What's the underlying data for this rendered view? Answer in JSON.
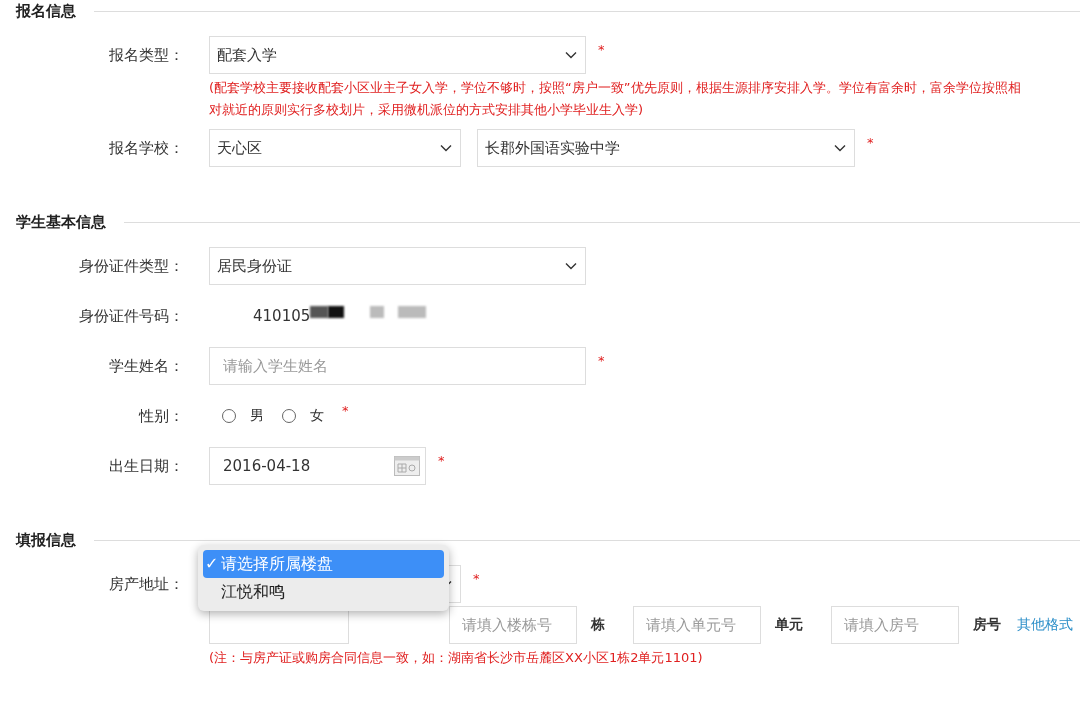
{
  "sections": [
    {
      "title": "报名信息",
      "rows": [
        {
          "kind": "select",
          "label": "报名类型：",
          "value": "配套入学",
          "required": "*",
          "note": "(配套学校主要接收配套小区业主子女入学，学位不够时，按照“房户一致”优先原则，根据生源排序安排入学。学位有富余时，富余学位按照相对就近的原则实行多校划片，采用微机派位的方式安排其他小学毕业生入学)"
        },
        {
          "kind": "select2",
          "label": "报名学校：",
          "value": "天心区",
          "value2": "长郡外国语实验中学",
          "required": "*"
        }
      ]
    },
    {
      "title": "学生基本信息",
      "rows": [
        {
          "kind": "select",
          "label": "身份证件类型：",
          "value": "居民身份证"
        },
        {
          "kind": "text",
          "label": "身份证件号码：",
          "value": "410105",
          "redacted": true
        },
        {
          "kind": "input",
          "label": "学生姓名：",
          "placeholder": "请输入学生姓名",
          "required": "*"
        },
        {
          "kind": "radio",
          "label": "性别：",
          "options": [
            {
              "label": "男",
              "selected": false
            },
            {
              "label": "女",
              "selected": false
            }
          ],
          "required": "*"
        },
        {
          "kind": "date",
          "label": "出生日期：",
          "value": "2016-04-18",
          "required": "*"
        }
      ]
    },
    {
      "title": "填报信息",
      "rows": [
        {
          "kind": "address",
          "label": "房产地址：",
          "required": "*",
          "check_mark": "✓",
          "menu": [
            {
              "label": "请选择所属楼盘",
              "selected": true
            },
            {
              "label": "江悦和鸣",
              "selected": false
            }
          ],
          "parts": [
            {
              "kind": "hidden"
            },
            {
              "placeholder": "请填入楼栋号",
              "unit": "栋"
            },
            {
              "placeholder": "请填入单元号",
              "unit": "单元"
            },
            {
              "placeholder": "请填入房号",
              "unit": "房号"
            }
          ],
          "link": "其他格式",
          "note": "(注：与房产证或购房合同信息一致，如：湖南省长沙市岳麓区XX小区1栋2单元1101)"
        }
      ]
    }
  ]
}
